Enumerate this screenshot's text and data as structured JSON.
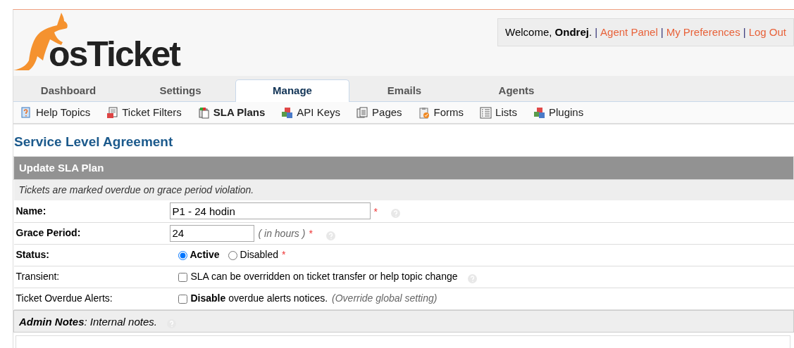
{
  "logo": {
    "text": "osTicket"
  },
  "user_box": {
    "welcome": "Welcome,",
    "user": "Ondrej",
    "period": ".",
    "links": [
      {
        "separator": "|",
        "label": "Agent Panel"
      },
      {
        "separator": "|",
        "label": "My Preferences"
      },
      {
        "separator": "|",
        "label": "Log Out"
      }
    ]
  },
  "tabs": [
    {
      "label": "Dashboard",
      "selected": false
    },
    {
      "label": "Settings",
      "selected": false
    },
    {
      "label": "Manage",
      "selected": true
    },
    {
      "label": "Emails",
      "selected": false
    },
    {
      "label": "Agents",
      "selected": false
    }
  ],
  "subnav": [
    {
      "label": "Help Topics",
      "selected": false
    },
    {
      "label": "Ticket Filters",
      "selected": false
    },
    {
      "label": "SLA Plans",
      "selected": true
    },
    {
      "label": "API Keys",
      "selected": false
    },
    {
      "label": "Pages",
      "selected": false
    },
    {
      "label": "Forms",
      "selected": false
    },
    {
      "label": "Lists",
      "selected": false
    },
    {
      "label": "Plugins",
      "selected": false
    }
  ],
  "page_title": "Service Level Agreement",
  "form": {
    "header": "Update SLA Plan",
    "note": "Tickets are marked overdue on grace period violation.",
    "fields": [
      {
        "kind": "text",
        "label": "Name:",
        "required_mark": "*",
        "help": true,
        "value": "P1 - 24 hodin"
      },
      {
        "kind": "number",
        "label": "Grace Period:",
        "required_mark": "*",
        "help": true,
        "value": "24",
        "hint": "( in hours )"
      },
      {
        "kind": "radio",
        "label": "Status:",
        "required_mark": "*",
        "help": false,
        "options": [
          {
            "label": "Active",
            "selected": true
          },
          {
            "label": "Disabled",
            "selected": false
          }
        ]
      },
      {
        "kind": "checkbox",
        "label": "Transient:",
        "help": true,
        "checked": false,
        "text": "SLA can be overridden on ticket transfer or help topic change"
      },
      {
        "kind": "checkbox",
        "label": "Ticket Overdue Alerts:",
        "help": false,
        "checked": false,
        "text": "**Disable** overdue alerts notices.",
        "hint": "(Override global setting)"
      }
    ],
    "notes_header": {
      "text": "**Admin Notes**: Internal notes.",
      "help": true
    }
  }
}
